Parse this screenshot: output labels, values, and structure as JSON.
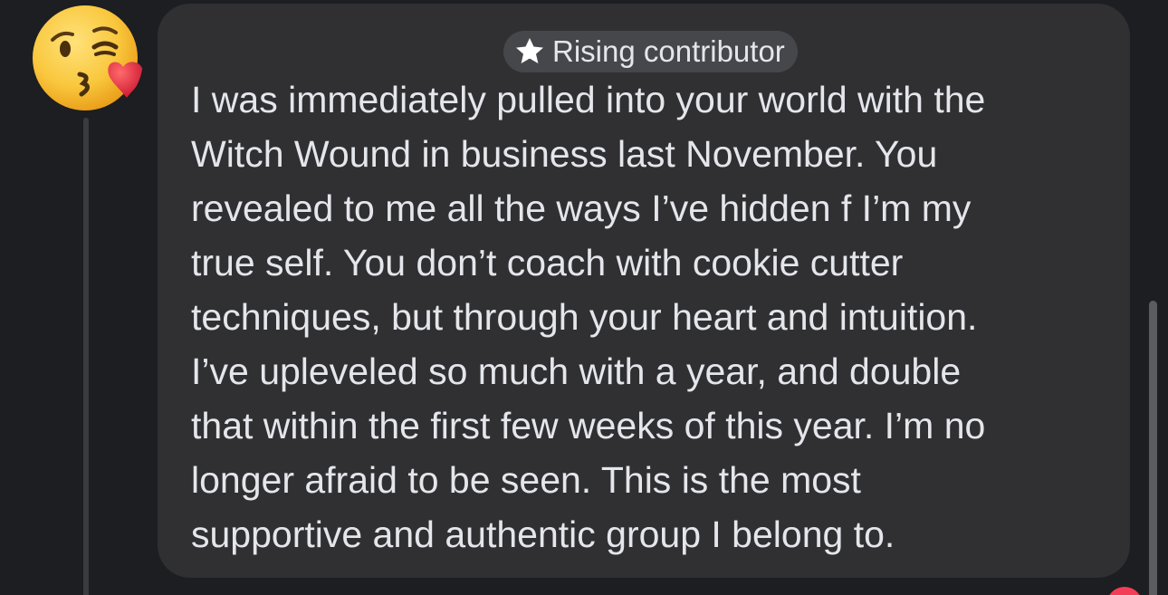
{
  "avatar": {
    "icon": "face-blowing-kiss-icon",
    "emoji_colors": {
      "face": "#f9c73d",
      "heart": "#e8263a"
    }
  },
  "badge": {
    "icon": "star-icon",
    "label": "Rising contributor"
  },
  "comment": {
    "text": "I was immediately pulled into your world with the\nWitch Wound in business last November. You\nrevealed to me all the ways I’ve hidden f I’m my\ntrue self. You don’t coach with cookie cutter\ntechniques, but through your heart and intuition.\nI’ve upleveled so much with a year, and double\nthat within the first few weeks of this year. I’m no\nlonger afraid to be seen. This is the most\nsupportive and authentic group I belong to."
  },
  "colors": {
    "background": "#1c1e21",
    "bubble": "#303033",
    "badge": "#46474b",
    "text": "#e4e6eb",
    "reaction": "#f33e58"
  }
}
